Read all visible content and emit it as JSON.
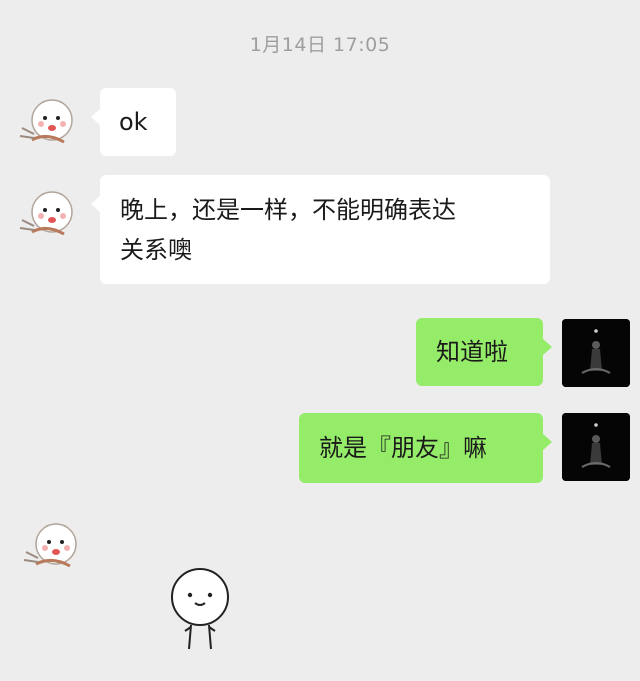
{
  "chat": {
    "timestamp": "1月14日 17:05",
    "messages": [
      {
        "side": "left",
        "text": "ok"
      },
      {
        "side": "left",
        "text": "晚上，还是一样，不能明确表达\n关系噢"
      },
      {
        "side": "right",
        "text": "知道啦"
      },
      {
        "side": "right",
        "text": "就是『朋友』嘛"
      },
      {
        "side": "left",
        "type": "sticker",
        "sticker": "stick-figure-sticker"
      }
    ]
  },
  "colors": {
    "background": "#ededed",
    "incoming_bubble": "#ffffff",
    "outgoing_bubble": "#95ec69",
    "timestamp_text": "#9e9e9e"
  }
}
